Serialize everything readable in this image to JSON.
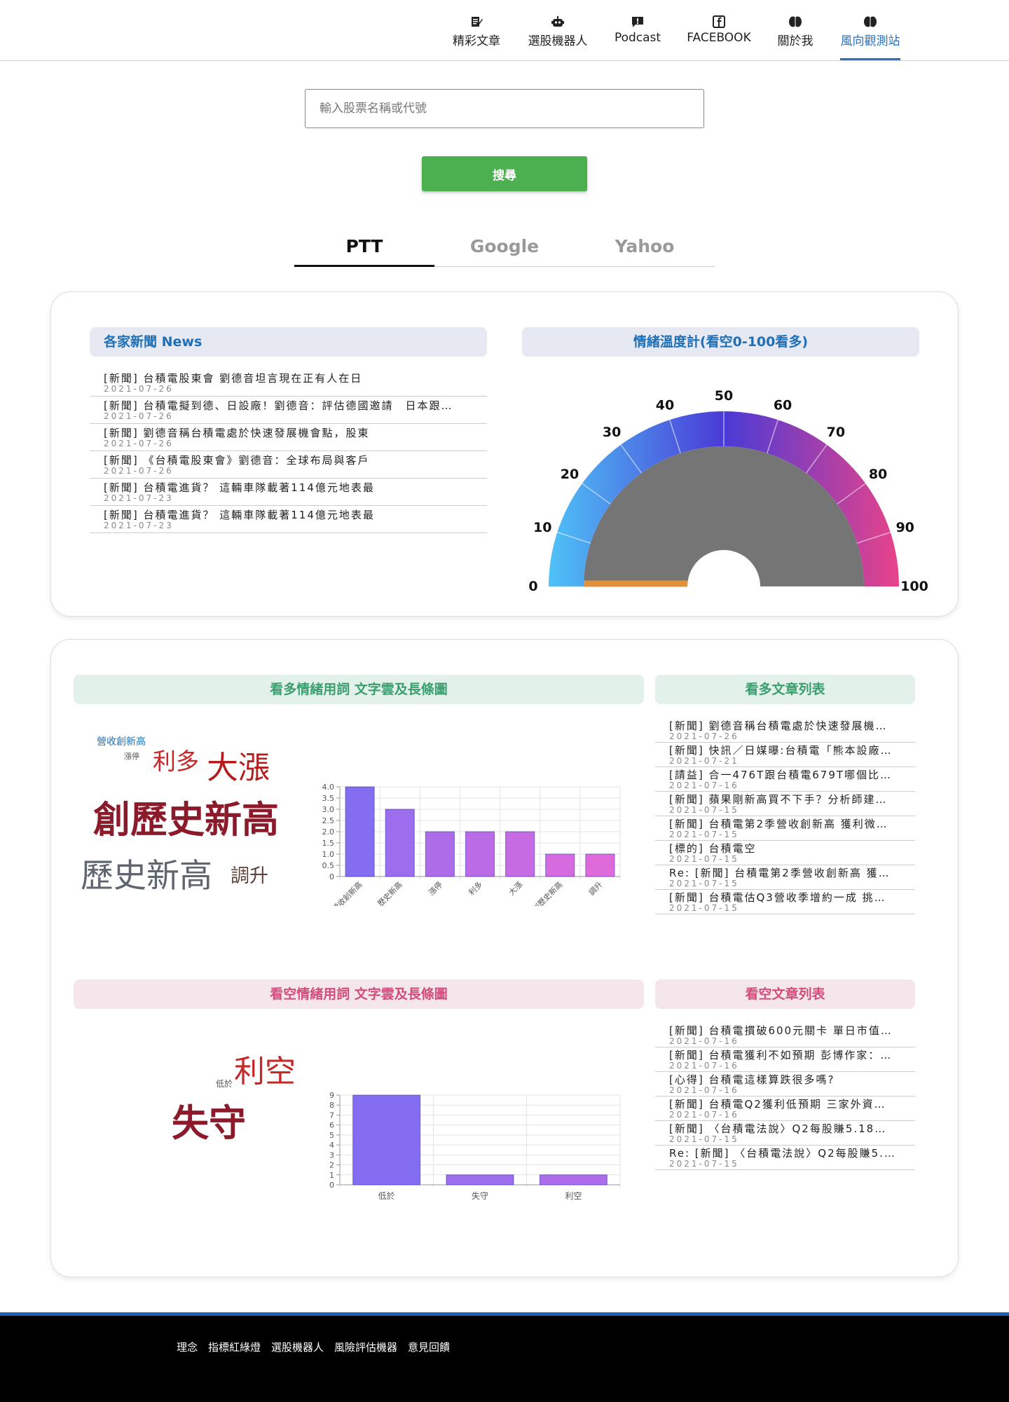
{
  "nav": {
    "items": [
      {
        "label": "精彩文章",
        "icon": "article-icon"
      },
      {
        "label": "選股機器人",
        "icon": "robot-icon"
      },
      {
        "label": "Podcast",
        "icon": "message-alert-icon"
      },
      {
        "label": "FACEBOOK",
        "icon": "facebook-icon"
      },
      {
        "label": "關於我",
        "icon": "brain-icon"
      },
      {
        "label": "風向觀測站",
        "icon": "brain-icon"
      }
    ],
    "active": "風向觀測站"
  },
  "search": {
    "placeholder": "輸入股票名稱或代號",
    "value": "",
    "button": "搜尋"
  },
  "tabs": [
    "PTT",
    "Google",
    "Yahoo"
  ],
  "active_tab": "PTT",
  "news": {
    "title": "各家新聞 News",
    "items": [
      {
        "title": "[新聞] 台積電股東會 劉德音坦言現在正有人在日",
        "date": "2021-07-26"
      },
      {
        "title": "[新聞] 台積電擬到德、日設廠！劉德音：評估德國邀請　日本跟…",
        "date": "2021-07-26"
      },
      {
        "title": "[新聞] 劉德音稱台積電處於快速發展機會點，股東",
        "date": "2021-07-26"
      },
      {
        "title": "[新聞] 《台積電股東會》劉德音：全球布局與客戶",
        "date": "2021-07-26"
      },
      {
        "title": "[新聞] 台積電進貨？ 這輛車隊載著114億元地表最",
        "date": "2021-07-23"
      },
      {
        "title": "[新聞] 台積電進貨？ 這輛車隊載著114億元地表最",
        "date": "2021-07-23"
      }
    ]
  },
  "gauge": {
    "title": "情緒溫度計(看空0-100看多)",
    "ticks": [
      "0",
      "10",
      "20",
      "30",
      "40",
      "50",
      "60",
      "70",
      "80",
      "90",
      "100"
    ],
    "value": 0,
    "colors": {
      "low": "#4fc3f7",
      "mid": "#4a3ad6",
      "high": "#e8438a",
      "inner": "#757575",
      "needle": "#e0913a"
    }
  },
  "bull": {
    "chart_title": "看多情緒用詞 文字雲及長條圖",
    "list_title": "看多文章列表",
    "words": [
      {
        "text": "營收創新高",
        "color": "#1e6fb5"
      },
      {
        "text": "漲停",
        "color": "#555555"
      },
      {
        "text": "利多",
        "color": "#c62828"
      },
      {
        "text": "大漲",
        "color": "#b71c1c"
      },
      {
        "text": "創歷史新高",
        "color": "#8b1a2b"
      },
      {
        "text": "歷史新高",
        "color": "#5f6670"
      },
      {
        "text": "調升",
        "color": "#5d4037"
      }
    ],
    "articles": [
      {
        "title": "[新聞] 劉德音稱台積電處於快速發展機…",
        "date": "2021-07-26"
      },
      {
        "title": "[新聞] 快訊／日媒曝:台積電「熊本設廠…",
        "date": "2021-07-21"
      },
      {
        "title": "[請益] 合一476T跟台積電679T哪個比…",
        "date": "2021-07-16"
      },
      {
        "title": "[新聞] 蘋果剛新高買不下手？分析師建…",
        "date": "2021-07-15"
      },
      {
        "title": "[新聞] 台積電第2季營收創新高 獲利微…",
        "date": "2021-07-15"
      },
      {
        "title": "[標的] 台積電空",
        "date": "2021-07-15"
      },
      {
        "title": "Re: [新聞] 台積電第2季營收創新高 獲…",
        "date": "2021-07-15"
      },
      {
        "title": "[新聞] 台積電估Q3營收季增約一成 挑…",
        "date": "2021-07-15"
      }
    ]
  },
  "bear": {
    "chart_title": "看空情緒用詞 文字雲及長條圖",
    "list_title": "看空文章列表",
    "words": [
      {
        "text": "低於",
        "color": "#555555"
      },
      {
        "text": "利空",
        "color": "#c62828"
      },
      {
        "text": "失守",
        "color": "#8b1a2b"
      }
    ],
    "articles": [
      {
        "title": "[新聞] 台積電摜破600元關卡 單日市值…",
        "date": "2021-07-16"
      },
      {
        "title": "[新聞] 台積電獲利不如預期 彭博作家：…",
        "date": "2021-07-16"
      },
      {
        "title": "[心得] 台積電這樣算跌很多嗎?",
        "date": "2021-07-16"
      },
      {
        "title": "[新聞] 台積電Q2獲利低預期 三家外資…",
        "date": "2021-07-16"
      },
      {
        "title": "[新聞] 〈台積電法說〉Q2每股賺5.18…",
        "date": "2021-07-15"
      },
      {
        "title": "Re: [新聞] 〈台積電法說〉Q2每股賺5.…",
        "date": "2021-07-15"
      }
    ]
  },
  "chart_data": [
    {
      "type": "bar",
      "categories": [
        "營收創新高",
        "歷史新高",
        "漲停",
        "利多",
        "大漲",
        "創歷史新高",
        "調升"
      ],
      "values": [
        4,
        3,
        2,
        2,
        2,
        1,
        1
      ],
      "ylim": [
        0,
        4
      ],
      "yticks": [
        "0",
        "0.5",
        "1.0",
        "1.5",
        "2.0",
        "2.5",
        "3.0",
        "3.5",
        "4.0"
      ],
      "colors": [
        "#7b61f0",
        "#9461ea",
        "#a65fe6",
        "#b65ee4",
        "#c25edf",
        "#d15edc",
        "#dc5ed8"
      ],
      "grid": true
    },
    {
      "type": "bar",
      "categories": [
        "低於",
        "失守",
        "利空"
      ],
      "values": [
        9,
        1,
        1
      ],
      "ylim": [
        0,
        9
      ],
      "yticks": [
        "0",
        "1",
        "2",
        "3",
        "4",
        "5",
        "6",
        "7",
        "8",
        "9"
      ],
      "colors": [
        "#7b61f0",
        "#9461ea",
        "#a65fe6"
      ],
      "grid": true
    }
  ],
  "footer": {
    "links": [
      "理念",
      "指標紅綠燈",
      "選股機器人",
      "風險評估機器",
      "意見回饋"
    ]
  }
}
